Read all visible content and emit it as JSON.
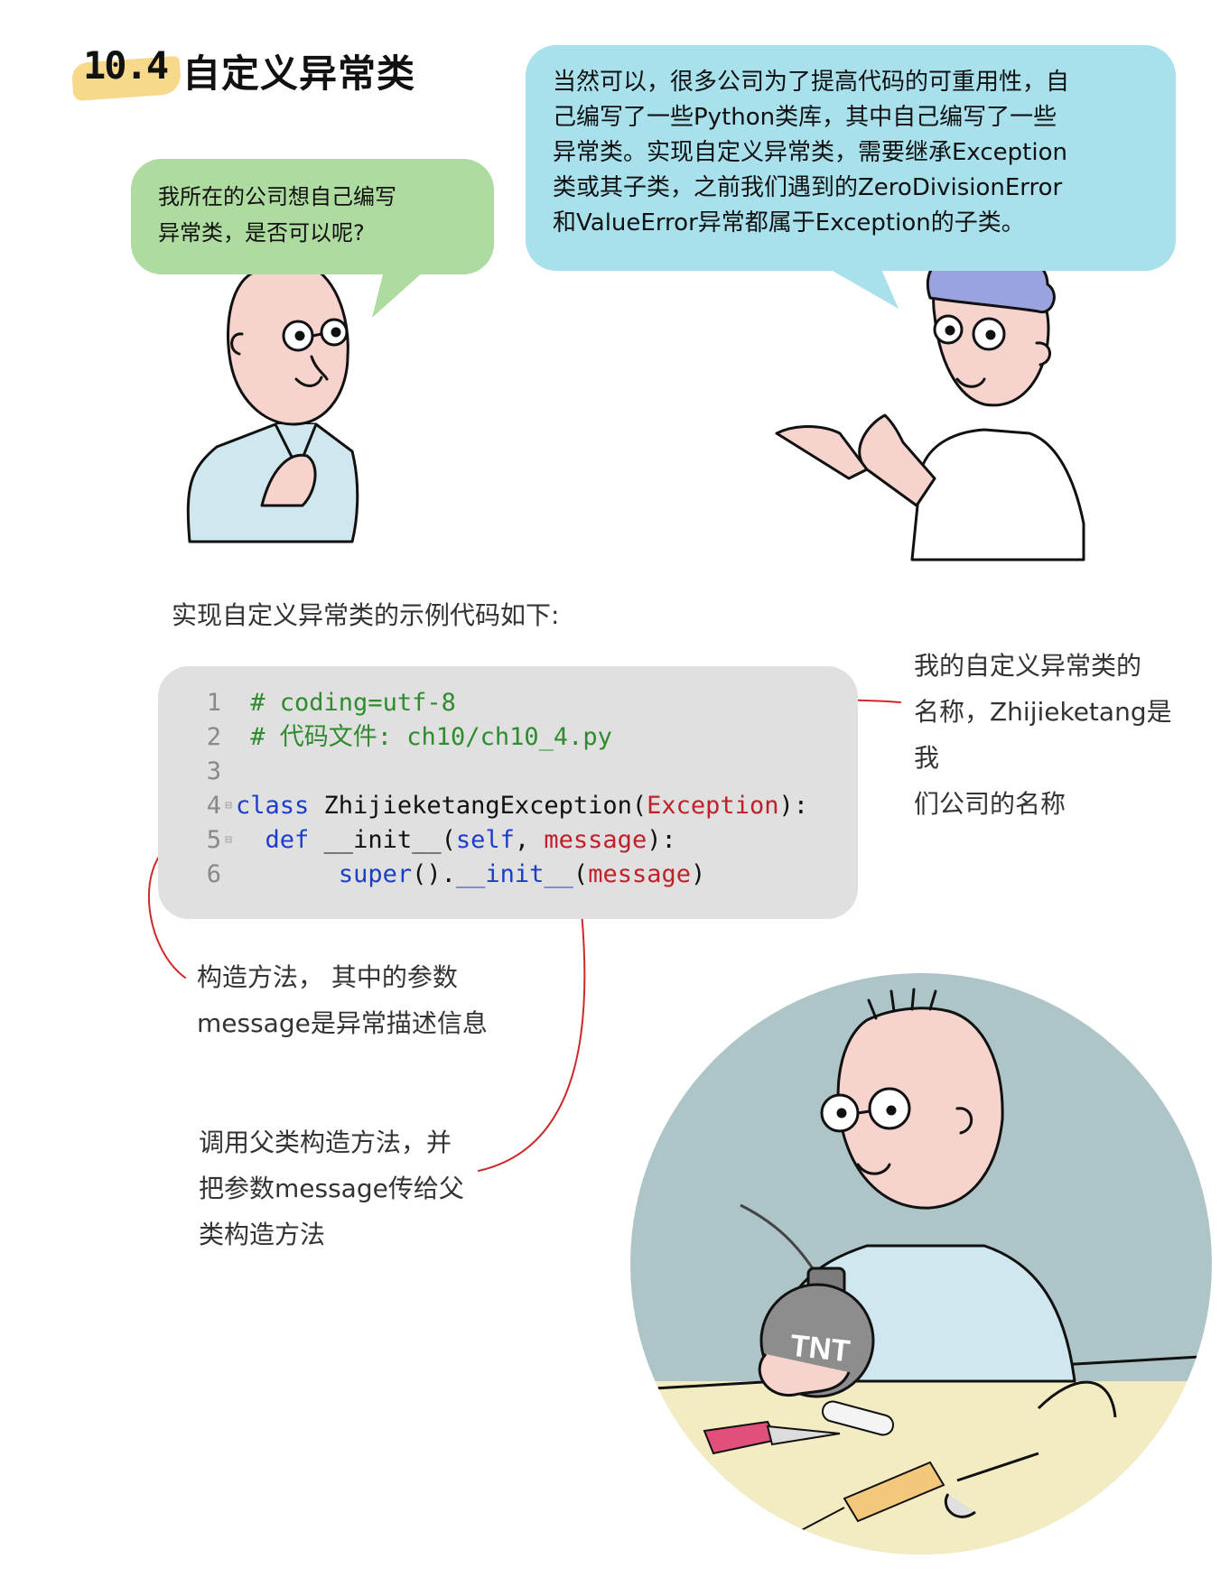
{
  "header": {
    "section_number": "10.4",
    "section_title": "自定义异常类"
  },
  "bubbles": {
    "left": [
      "我所在的公司想自己编写",
      "异常类，是否可以呢?"
    ],
    "right": [
      "当然可以，很多公司为了提高代码的可重用性，自",
      "己编写了一些Python类库，其中自己编写了一些",
      "异常类。实现自定义异常类，需要继承Exception",
      "类或其子类，之前我们遇到的ZeroDivisionError",
      "和ValueError异常都属于Exception的子类。"
    ]
  },
  "intro": "实现自定义异常类的示例代码如下:",
  "code": {
    "line_numbers": [
      "1",
      "2",
      "3",
      "4",
      "5",
      "6"
    ],
    "line1": "# coding=utf-8",
    "line2": "# 代码文件: ch10/ch10_4.py",
    "line4": {
      "kw": "class",
      "name": " ZhijieketangException(",
      "base": "Exception",
      "end": "):"
    },
    "line5": {
      "indent": "  ",
      "kw": "def",
      "name": " __init__(",
      "self": "self",
      "comma": ", ",
      "param": "message",
      "end": "):"
    },
    "line6": {
      "indent": "      ",
      "super": "super",
      "mid": "().",
      "init": "__init__",
      "open": "(",
      "param": "message",
      "close": ")"
    }
  },
  "annotations": {
    "classname": [
      "我的自定义异常类的",
      "名称，Zhijieketang是我",
      "们公司的名称"
    ],
    "ctor": [
      "构造方法， 其中的参数",
      "message是异常描述信息"
    ],
    "super_call": [
      "调用父类构造方法，并",
      "把参数message传给父",
      "类构造方法"
    ]
  },
  "illustration": {
    "bomb_label": "TNT"
  },
  "colors": {
    "bubble_left": "#aedba0",
    "bubble_right": "#a8e0ec",
    "code_bg": "#e0e0e0",
    "arrow": "#cc2a2a",
    "circle_bg": "#aec5c8",
    "table": "#f3ecc2"
  }
}
